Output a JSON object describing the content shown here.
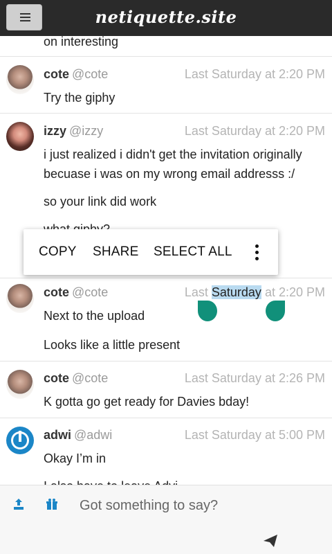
{
  "app": {
    "brand": "netiquette.site"
  },
  "header": {
    "menu_icon": "hamburger-icon"
  },
  "messages": [
    {
      "id": "m0",
      "name": "",
      "handle": "",
      "time": "",
      "lines": [
        "on interesting"
      ]
    },
    {
      "id": "m1",
      "name": "cote",
      "handle": "@cote",
      "time": "Last Saturday at 2:20 PM",
      "lines": [
        "Try the giphy"
      ]
    },
    {
      "id": "m2",
      "name": "izzy",
      "handle": "@izzy",
      "time": "Last Saturday at 2:20 PM",
      "lines": [
        "i just realized i didn't get the invitation originally",
        "becuase i was on my wrong email addresss :/",
        "so your link did work",
        "what giphy?"
      ]
    },
    {
      "id": "m3",
      "name": "cote",
      "handle": "@cote",
      "time_prefix": "Last",
      "time_selected": "Saturday",
      "time_suffix": "at 2:20 PM",
      "lines": [
        "Next to the upload",
        "Looks like a little present"
      ]
    },
    {
      "id": "m4",
      "name": "cote",
      "handle": "@cote",
      "time": "Last Saturday at 2:26 PM",
      "lines": [
        "K gotta go get ready for Davies bday!"
      ]
    },
    {
      "id": "m5",
      "name": "adwi",
      "handle": "@adwi",
      "time": "Last Saturday at 5:00 PM",
      "lines": [
        "Okay I’m in",
        "I also have to leave Advi..."
      ]
    }
  ],
  "context_menu": {
    "copy": "COPY",
    "share": "SHARE",
    "select_all": "SELECT ALL",
    "more_icon": "more-vertical-icon"
  },
  "composer": {
    "placeholder": "Got something to say?",
    "upload_icon": "upload-icon",
    "gift_icon": "gift-icon",
    "send_icon": "send-icon"
  }
}
